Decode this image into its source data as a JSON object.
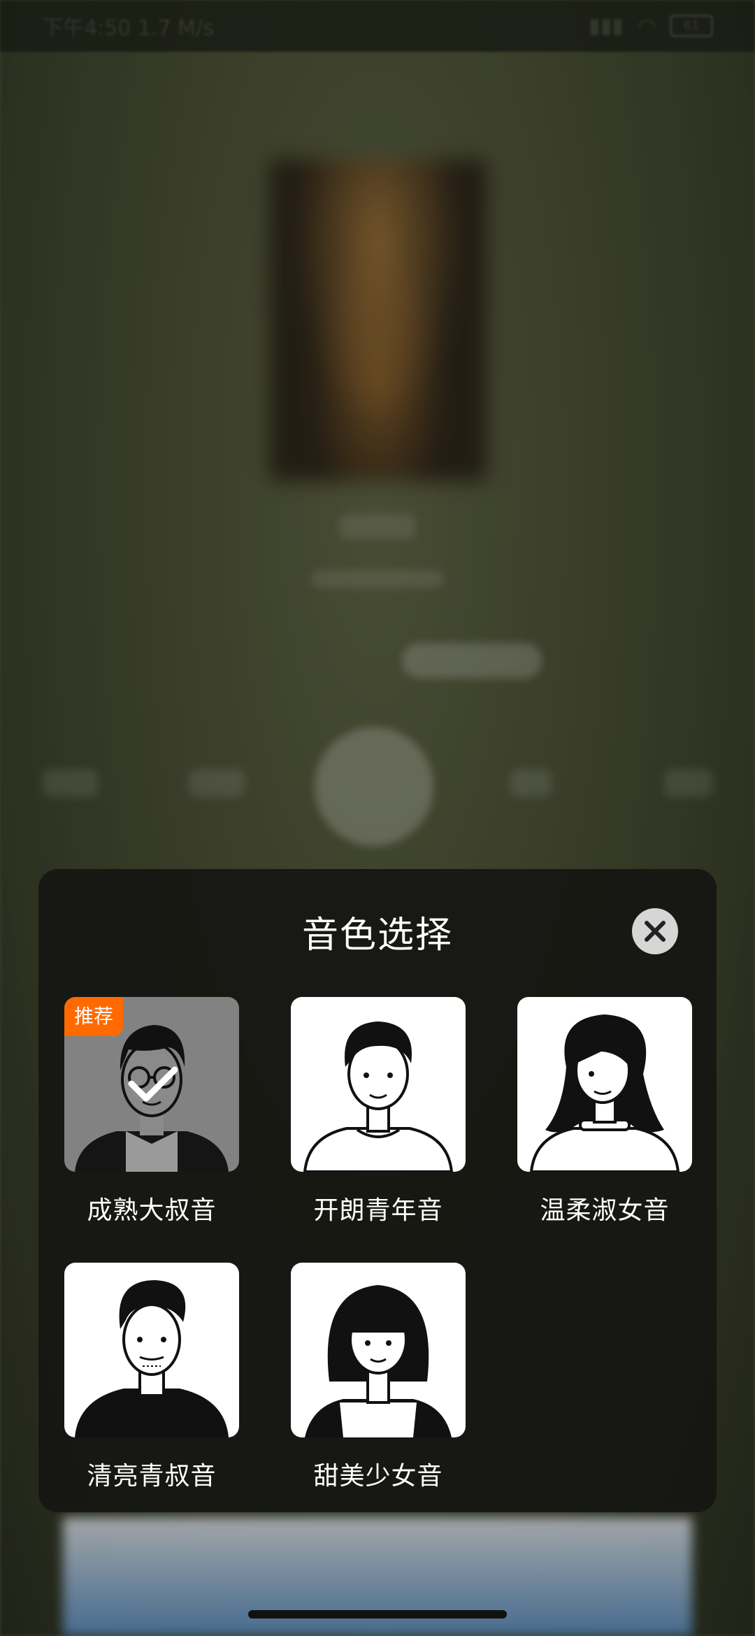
{
  "status_bar": {
    "time": "下午4:50",
    "speed": "1.7 M/s",
    "battery": "61"
  },
  "dialog": {
    "title": "音色选择",
    "recommended_badge": "推荐",
    "voices": [
      {
        "label": "成熟大叔音",
        "selected": true,
        "recommended": true
      },
      {
        "label": "开朗青年音",
        "selected": false,
        "recommended": false
      },
      {
        "label": "温柔淑女音",
        "selected": false,
        "recommended": false
      },
      {
        "label": "清亮青叔音",
        "selected": false,
        "recommended": false
      },
      {
        "label": "甜美少女音",
        "selected": false,
        "recommended": false
      }
    ]
  },
  "colors": {
    "badge": "#ff6a00",
    "dialog_bg": "#161612",
    "selected_tile": "#828282"
  }
}
